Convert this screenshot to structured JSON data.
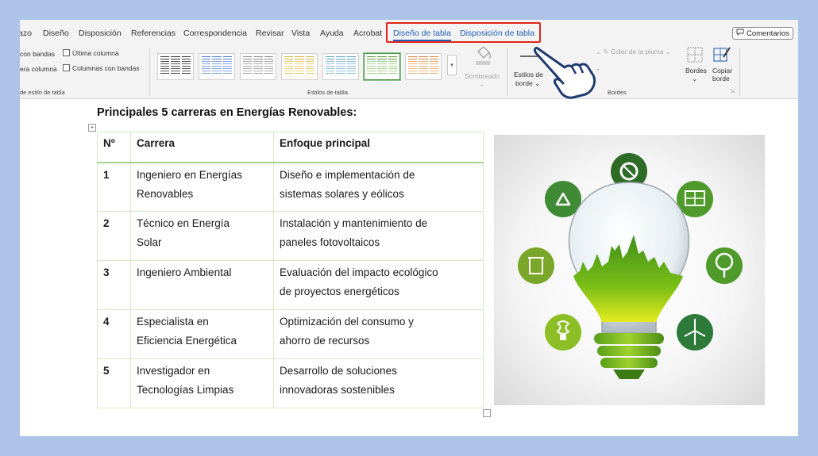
{
  "menu": {
    "tabs": [
      {
        "label": "azo"
      },
      {
        "label": "Diseño"
      },
      {
        "label": "Disposición"
      },
      {
        "label": "Referencias"
      },
      {
        "label": "Correspondencia"
      },
      {
        "label": "Revisar"
      },
      {
        "label": "Vista"
      },
      {
        "label": "Ayuda"
      },
      {
        "label": "Acrobat"
      },
      {
        "label": "Diseño de tabla"
      },
      {
        "label": "Disposición de tabla"
      }
    ],
    "comments_label": "Comentarios"
  },
  "ribbon": {
    "options": {
      "banded_rows": "con bandas",
      "last_column": "Última columna",
      "first_column": "era columna",
      "banded_columns": "Columnas con bandas",
      "group_label": "de estilo de tabla"
    },
    "styles": {
      "group_label": "Estilos de tabla",
      "shading_label": "Sombreado"
    },
    "borders": {
      "border_styles_label_1": "Estilos de",
      "border_styles_label_2": "borde",
      "pen_color_label": "Color de la pluma",
      "borders_label": "Bordes",
      "copy_border_label_1": "Copiar",
      "copy_border_label_2": "borde",
      "group_label": "Bordes"
    },
    "colors": {
      "accent": "#1f5fb7",
      "highlight": "#e0251b"
    }
  },
  "document": {
    "title": "Principales 5 carreras en Energías Renovables:",
    "table": {
      "headers": [
        "Nº",
        "Carrera",
        "Enfoque principal"
      ],
      "rows": [
        {
          "num": "1",
          "career_1": "Ingeniero en Energías",
          "career_2": "Renovables",
          "focus_1": "Diseño e implementación de",
          "focus_2": "sistemas solares y eólicos"
        },
        {
          "num": "2",
          "career_1": "Técnico en Energía",
          "career_2": "Solar",
          "focus_1": "Instalación y mantenimiento de",
          "focus_2": "paneles fotovoltaicos"
        },
        {
          "num": "3",
          "career_1": "Ingeniero Ambiental",
          "career_2": "",
          "focus_1": "Evaluación del impacto ecológico",
          "focus_2": "de proyectos energéticos"
        },
        {
          "num": "4",
          "career_1": "Especialista en",
          "career_2": "Eficiencia Energética",
          "focus_1": "Optimización del consumo y",
          "focus_2": "ahorro de recursos"
        },
        {
          "num": "5",
          "career_1": "Investigador en",
          "career_2": "Tecnologías Limpias",
          "focus_1": "Desarrollo de soluciones",
          "focus_2": "innovadoras sostenibles"
        }
      ]
    }
  },
  "illustration": {
    "icons": [
      "renewable-energy-cycle-icon",
      "recycle-icon",
      "solar-panel-icon",
      "tree-icon",
      "recycling-bin-icon",
      "wind-turbine-icon",
      "energy-saving-bulb-icon"
    ]
  }
}
